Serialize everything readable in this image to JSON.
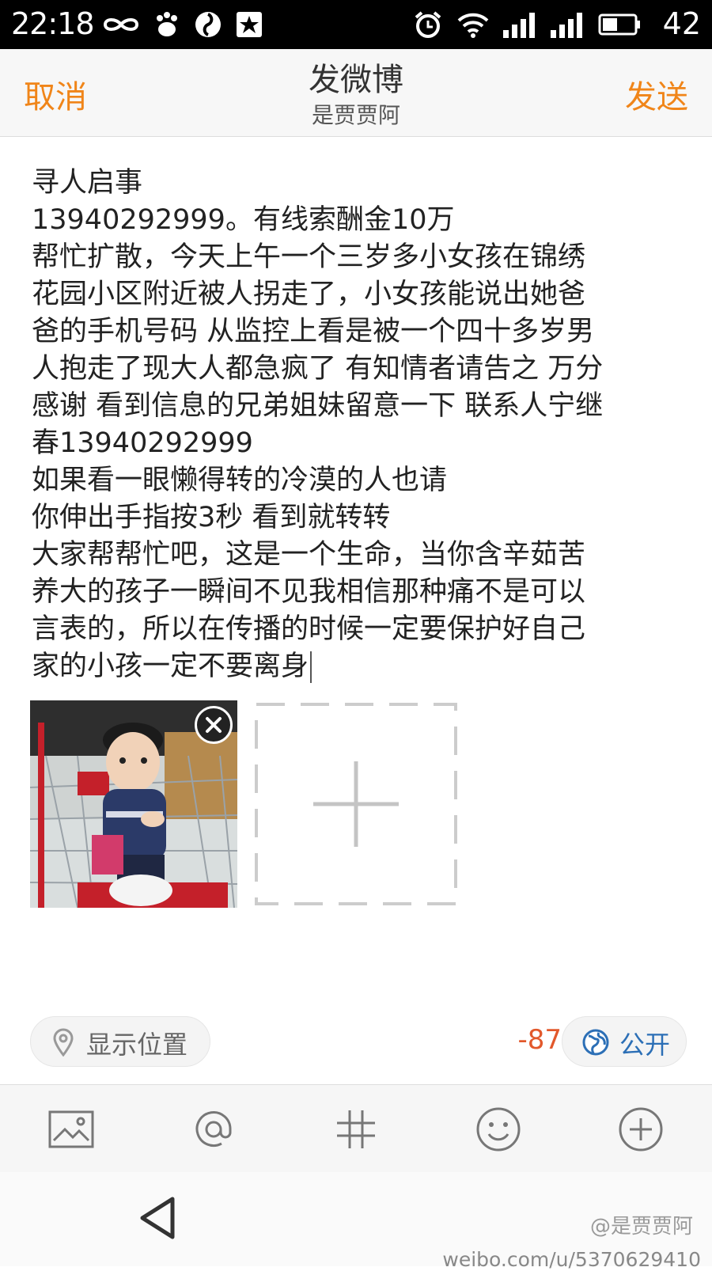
{
  "status_bar": {
    "time": "22:18",
    "battery": "42"
  },
  "header": {
    "cancel": "取消",
    "title": "发微博",
    "subtitle": "是贾贾阿",
    "send": "发送"
  },
  "compose": {
    "lines": [
      "寻人启事",
      "13940292999。有线索酬金10万",
      "帮忙扩散，今天上午一个三岁多小女孩在锦绣",
      "花园小区附近被人拐走了，小女孩能说出她爸",
      "爸的手机号码 从监控上看是被一个四十多岁男",
      "人抱走了现大人都急疯了 有知情者请告之 万分",
      "感谢 看到信息的兄弟姐妹留意一下 联系人宁继",
      "春13940292999",
      "如果看一眼懒得转的冷漠的人也请",
      "你伸出手指按3秒 看到就转转",
      "大家帮帮忙吧，这是一个生命，当你含辛茹苦",
      "养大的孩子一瞬间不见我相信那种痛不是可以",
      "言表的，所以在传播的时候一定要保护好自己",
      "家的小孩一定不要离身"
    ]
  },
  "location_label": "显示位置",
  "char_count": "-87",
  "visibility_label": "公开",
  "watermark": {
    "handle": "@是贾贾阿",
    "url": "weibo.com/u/5370629410"
  },
  "colors": {
    "accent": "#f08519",
    "counter": "#e2582b",
    "link": "#2c6fb6"
  }
}
